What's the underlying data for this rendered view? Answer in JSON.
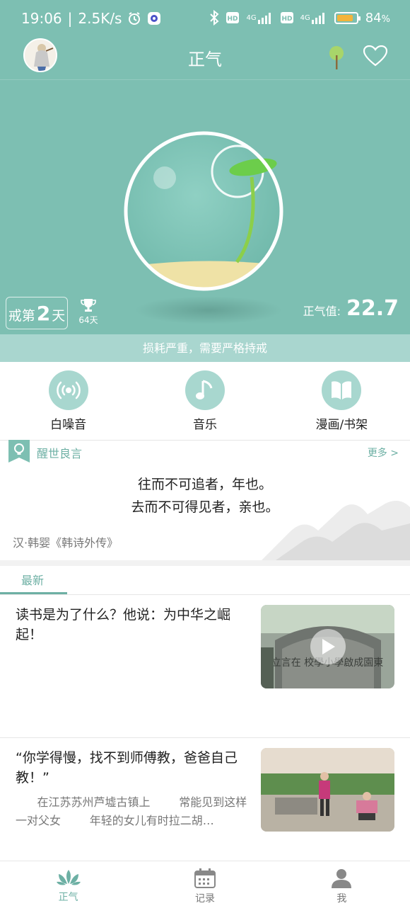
{
  "status_bar": {
    "time": "19:06",
    "net_speed": "2.5K/s",
    "network_1": "4G",
    "network_2": "4G",
    "hd": "HD",
    "battery": "84",
    "battery_unit": "%",
    "battery_level": 0.84
  },
  "app_bar": {
    "title": "正气"
  },
  "hero": {
    "quit_prefix": "戒第",
    "quit_days": "2",
    "quit_suffix": "天",
    "record_days": "64天",
    "zq_label": "正气值:",
    "zq_value": "22.7",
    "hint": "损耗严重，需要严格持戒"
  },
  "actions": [
    {
      "label": "白噪音",
      "icon": "broadcast-icon"
    },
    {
      "label": "音乐",
      "icon": "music-note-icon"
    },
    {
      "label": "漫画/书架",
      "icon": "open-book-icon"
    }
  ],
  "quote": {
    "title": "醒世良言",
    "more": "更多 >",
    "lines": [
      "往而不可追者，年也。",
      "去而不可得见者，亲也。"
    ],
    "source": "汉·韩婴《韩诗外传》"
  },
  "tabs": {
    "latest": "最新"
  },
  "articles": [
    {
      "title": "读书是为了什么？他说：为中华之崛起！",
      "desc": "",
      "thumb_text": "立言在 校學小學啟成園東"
    },
    {
      "title": "“你学得慢，找不到师傅教，爸爸自己教！”",
      "desc": "      在江苏苏州芦墟古镇上        常能见到这样一对父女        年轻的女儿有时拉二胡…",
      "thumb_text": ""
    }
  ],
  "bottom_nav": [
    {
      "label": "正气",
      "icon": "lotus-icon",
      "active": true
    },
    {
      "label": "记录",
      "icon": "calendar-icon",
      "active": false
    },
    {
      "label": "我",
      "icon": "user-icon",
      "active": false
    }
  ],
  "colors": {
    "teal": "#7dbfb2",
    "teal_light": "#a9d6cf",
    "accent": "#6db0a4",
    "battery": "#f3b43b"
  }
}
